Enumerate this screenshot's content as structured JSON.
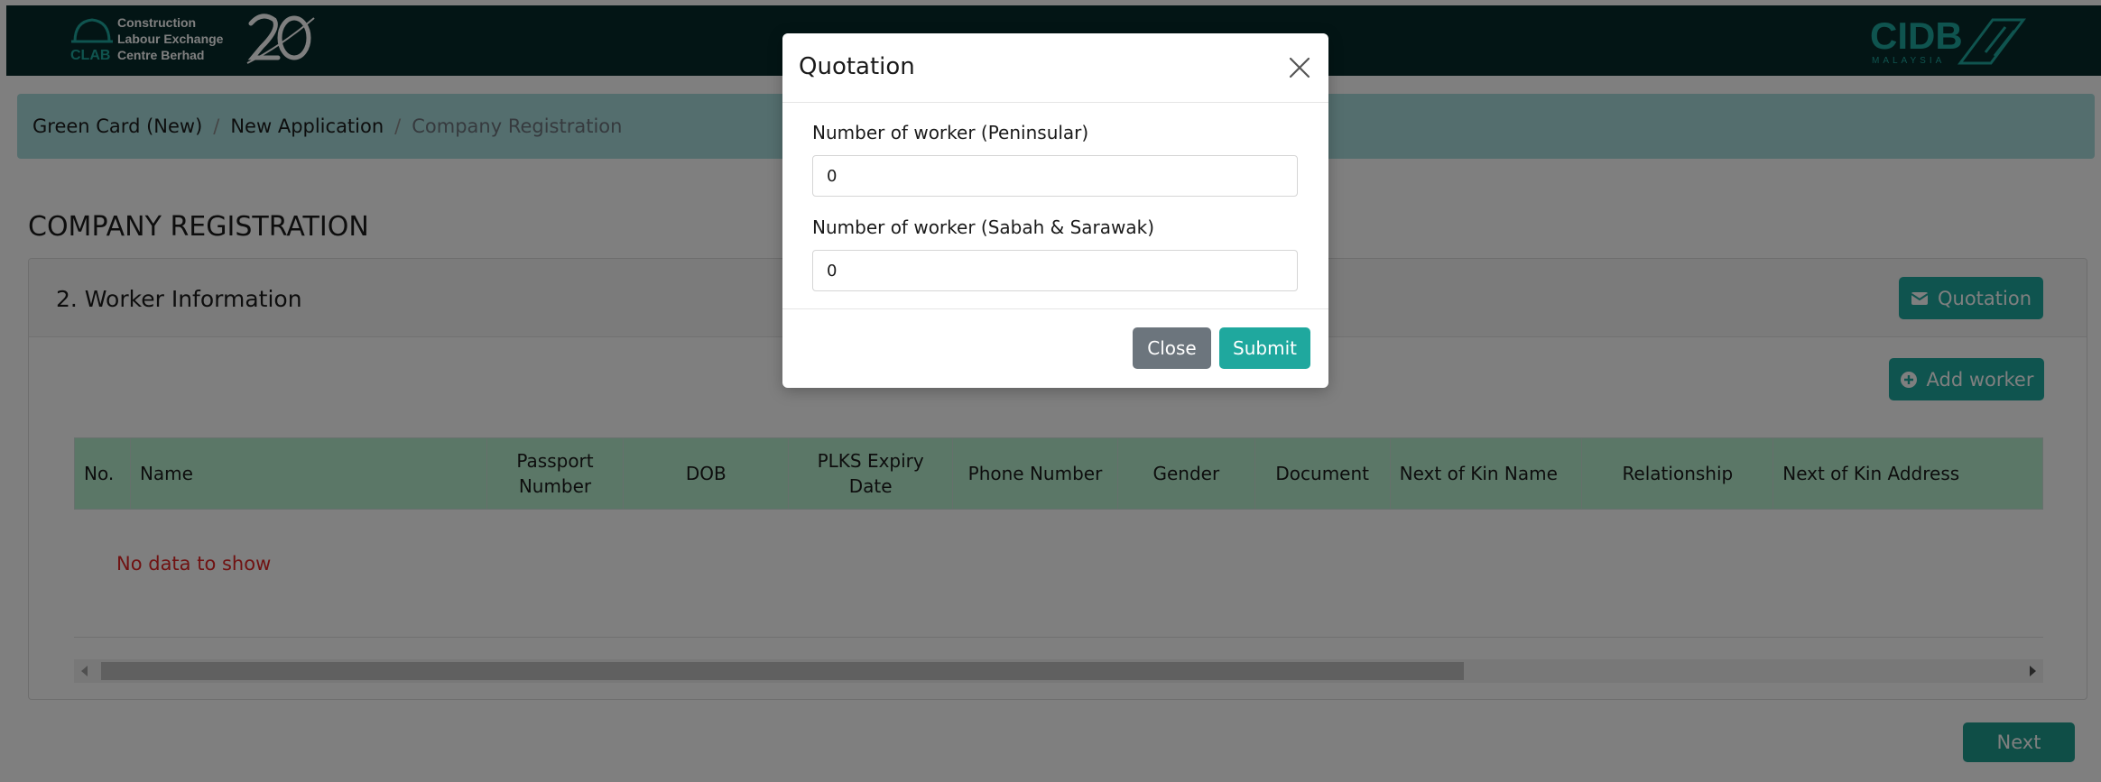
{
  "header": {
    "logo_text_lines": [
      "Construction",
      "Labour Exchange",
      "Centre Berhad"
    ],
    "logo_mark": "CLAB",
    "right_logo": "CIDB",
    "right_logo_sub": "MALAYSIA"
  },
  "breadcrumb": {
    "items": [
      "Green Card (New)",
      "New Application"
    ],
    "current": "Company Registration",
    "separator": "/"
  },
  "page": {
    "title": "COMPANY REGISTRATION"
  },
  "worker_section": {
    "title": "2. Worker Information",
    "quotation_button": "Quotation",
    "add_worker_button": "Add worker",
    "table": {
      "columns": [
        "No.",
        "Name",
        "Passport Number",
        "DOB",
        "PLKS Expiry Date",
        "Phone Number",
        "Gender",
        "Document",
        "Next of Kin Name",
        "Relationship",
        "Next of Kin Address"
      ],
      "empty_message": "No data to show"
    }
  },
  "footer": {
    "next_button": "Next"
  },
  "modal": {
    "title": "Quotation",
    "fields": [
      {
        "label": "Number of worker (Peninsular)",
        "value": "0"
      },
      {
        "label": "Number of worker (Sabah & Sarawak)",
        "value": "0"
      }
    ],
    "close_button": "Close",
    "submit_button": "Submit"
  },
  "colors": {
    "navbar": "#072a2a",
    "breadcrumb_bg": "#a9dcdc",
    "accent_teal": "#1fa89e",
    "table_header": "#b7eecf",
    "error_text": "#e02424",
    "secondary_button": "#6c757d"
  },
  "icons": [
    "clab-helmet-icon",
    "anniversary-20-icon",
    "cidb-logo-icon",
    "envelope-icon",
    "plus-circle-icon",
    "close-icon"
  ]
}
